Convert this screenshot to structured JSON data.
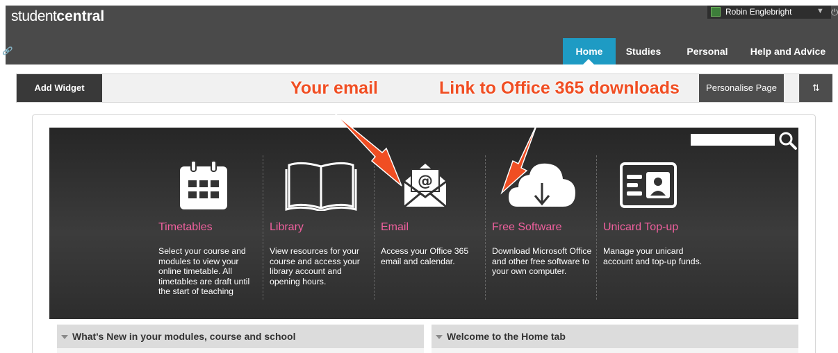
{
  "header": {
    "logo_light": "student",
    "logo_bold": "central",
    "user_name": "Robin Englebright",
    "nav": [
      "Home",
      "Studies",
      "Personal",
      "Help and Advice"
    ]
  },
  "toolbar": {
    "add_widget": "Add Widget",
    "personalise": "Personalise Page",
    "reorder": "⇅"
  },
  "annotations": {
    "email": "Your email",
    "office": "Link to Office 365 downloads"
  },
  "cards": [
    {
      "title": "Timetables",
      "desc": "Select your course and modules to view your online timetable. All timetables are draft until the start of teaching",
      "icon": "calendar-icon"
    },
    {
      "title": "Library",
      "desc": "View resources for your course and access your library account and opening hours.",
      "icon": "book-icon"
    },
    {
      "title": "Email",
      "desc": "Access your Office 365 email and calendar.",
      "icon": "envelope-icon"
    },
    {
      "title": "Free Software",
      "desc": "Download Microsoft Office and other free software to your own computer.",
      "icon": "cloud-download-icon"
    },
    {
      "title": "Unicard Top-up",
      "desc": "Manage your unicard account and top-up funds.",
      "icon": "id-card-icon"
    }
  ],
  "widgets": {
    "left": "What's New in your modules, course and school",
    "right": "Welcome to the Home tab"
  },
  "colors": {
    "accent": "#1e9bc4",
    "pink": "#f0609e",
    "annotation": "#f04e23"
  }
}
